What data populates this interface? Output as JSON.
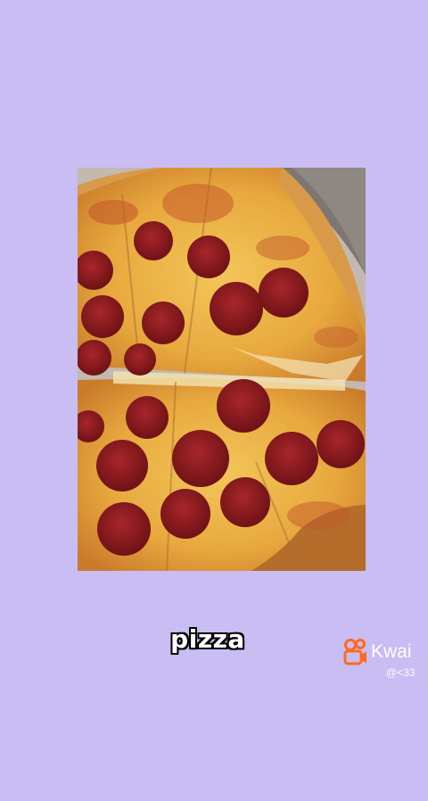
{
  "caption": "pizza",
  "watermark": {
    "brand": "Kwai",
    "handle": "@<33",
    "icon": "kwai-camera-icon",
    "brand_color": "#ff6a1c"
  },
  "background_color": "#c9bdf3"
}
